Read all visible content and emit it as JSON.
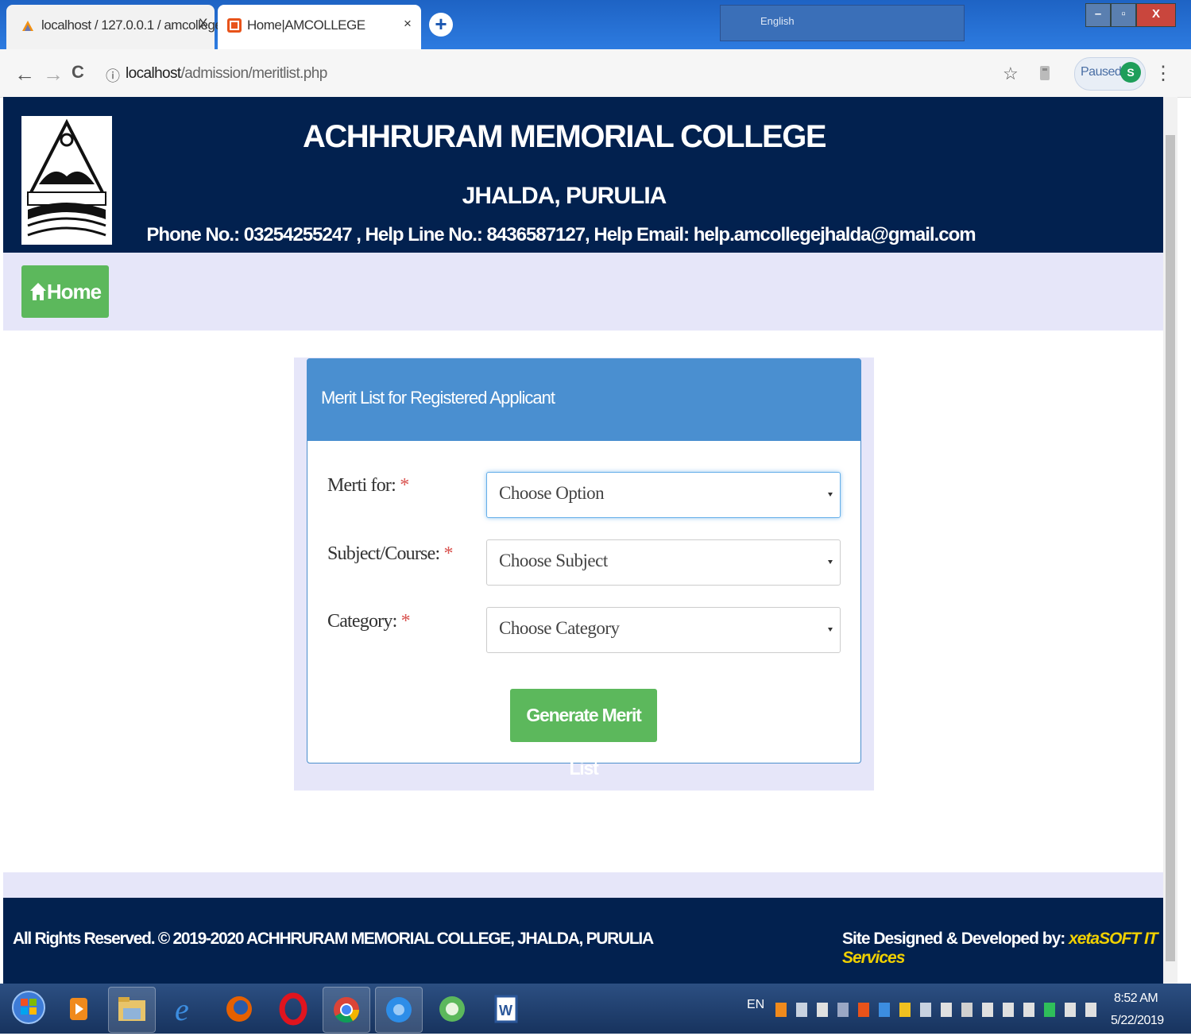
{
  "browser": {
    "tabs": [
      {
        "title": "localhost / 127.0.0.1 / amcollege",
        "close": "X"
      },
      {
        "title": "Home|AMCOLLEGE",
        "close": "×"
      }
    ],
    "new_tab": "+",
    "lang_bar": "English",
    "window_controls": {
      "minimize": "–",
      "maximize": "▫",
      "close": "X"
    },
    "nav": {
      "back": "←",
      "forward": "→",
      "reload": "C"
    },
    "url_host": "localhost",
    "url_path": "/admission/meritlist.php",
    "info_icon": "ⓘ",
    "bookmark": "☆",
    "profile_status": "Paused",
    "profile_initial": "S",
    "menu": "⋮"
  },
  "header": {
    "college_name": "ACHHRURAM MEMORIAL COLLEGE",
    "place": "JHALDA, PURULIA",
    "contact": "Phone No.: 03254255247 , Help Line No.: 8436587127, Help Email: help.amcollegejhalda@gmail.com"
  },
  "nav": {
    "home_label": "Home"
  },
  "panel": {
    "title": "Merit List for Registered Applicant",
    "fields": [
      {
        "label": "Merti for:",
        "required": "*",
        "selected": "Choose Option"
      },
      {
        "label": "Subject/Course:",
        "required": "*",
        "selected": "Choose Subject"
      },
      {
        "label": "Category:",
        "required": "*",
        "selected": "Choose Category"
      }
    ],
    "submit_label": "Generate Merit List"
  },
  "footer": {
    "copyright": "All Rights Reserved. © 2019-2020 ACHHRURAM MEMORIAL COLLEGE, JHALDA, PURULIA",
    "credit_prefix": "Site Designed & Developed by: ",
    "credit_brand": "xetaSOFT IT Services"
  },
  "taskbar": {
    "lang": "EN",
    "time": "8:52 AM",
    "date": "5/22/2019",
    "apps": [
      "windows-media-player",
      "file-explorer",
      "internet-explorer",
      "firefox",
      "opera",
      "chrome",
      "chrome-canary",
      "unknown-app",
      "microsoft-word"
    ]
  },
  "colors": {
    "header_bg": "#02214f",
    "panel_head": "#4a8fd0",
    "button_green": "#5cb85c",
    "strip_bg": "#e6e6f9",
    "brand_yellow": "#f0d000"
  }
}
